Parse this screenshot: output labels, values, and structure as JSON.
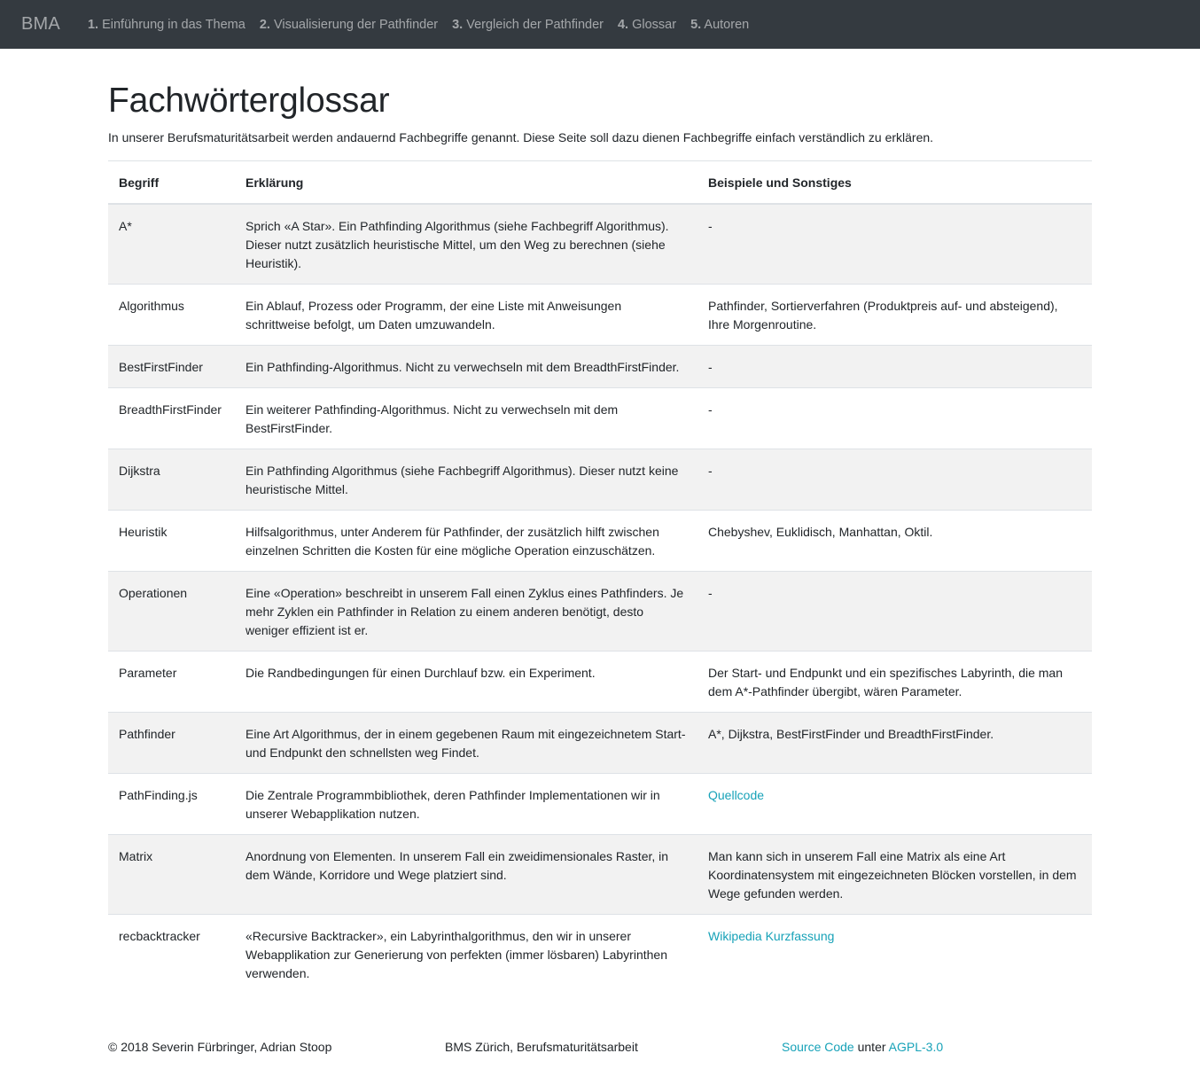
{
  "navbar": {
    "brand": "BMA",
    "links": [
      {
        "num": "1.",
        "label": "Einführung in das Thema"
      },
      {
        "num": "2.",
        "label": "Visualisierung der Pathfinder"
      },
      {
        "num": "3.",
        "label": "Vergleich der Pathfinder"
      },
      {
        "num": "4.",
        "label": "Glossar"
      },
      {
        "num": "5.",
        "label": "Autoren"
      }
    ]
  },
  "page": {
    "title": "Fachwörterglossar",
    "intro": "In unserer Berufsmaturitätsarbeit werden andauernd Fachbegriffe genannt. Diese Seite soll dazu dienen Fachbegriffe einfach verständlich zu erklären."
  },
  "table": {
    "headers": [
      "Begriff",
      "Erklärung",
      "Beispiele und Sonstiges"
    ],
    "rows": [
      {
        "term": "A*",
        "explanation": "Sprich «A Star». Ein Pathfinding Algorithmus (siehe Fachbegriff Algorithmus). Dieser nutzt zusätzlich heuristische Mittel, um den Weg zu berechnen (siehe Heuristik).",
        "extra": "-",
        "extra_is_link": false
      },
      {
        "term": "Algorithmus",
        "explanation": "Ein Ablauf, Prozess oder Programm, der eine Liste mit Anweisungen schrittweise befolgt, um Daten umzuwandeln.",
        "extra": "Pathfinder, Sortierverfahren (Produktpreis auf- und absteigend), Ihre Morgenroutine.",
        "extra_is_link": false
      },
      {
        "term": "BestFirstFinder",
        "explanation": "Ein Pathfinding-Algorithmus. Nicht zu verwechseln mit dem BreadthFirstFinder.",
        "extra": "-",
        "extra_is_link": false
      },
      {
        "term": "BreadthFirstFinder",
        "explanation": "Ein weiterer Pathfinding-Algorithmus. Nicht zu verwechseln mit dem BestFirstFinder.",
        "extra": "-",
        "extra_is_link": false
      },
      {
        "term": "Dijkstra",
        "explanation": "Ein Pathfinding Algorithmus (siehe Fachbegriff Algorithmus). Dieser nutzt keine heuristische Mittel.",
        "extra": "-",
        "extra_is_link": false
      },
      {
        "term": "Heuristik",
        "explanation": "Hilfsalgorithmus, unter Anderem für Pathfinder, der zusätzlich hilft zwischen einzelnen Schritten die Kosten für eine mögliche Operation einzuschätzen.",
        "extra": "Chebyshev, Euklidisch, Manhattan, Oktil.",
        "extra_is_link": false
      },
      {
        "term": "Operationen",
        "explanation": "Eine «Operation» beschreibt in unserem Fall einen Zyklus eines Pathfinders. Je mehr Zyklen ein Pathfinder in Relation zu einem anderen benötigt, desto weniger effizient ist er.",
        "extra": "-",
        "extra_is_link": false
      },
      {
        "term": "Parameter",
        "explanation": "Die Randbedingungen für einen Durchlauf bzw. ein Experiment.",
        "extra": "Der Start- und Endpunkt und ein spezifisches Labyrinth, die man dem A*-Pathfinder übergibt, wären Parameter.",
        "extra_is_link": false
      },
      {
        "term": "Pathfinder",
        "explanation": "Eine Art Algorithmus, der in einem gegebenen Raum mit eingezeichnetem Start- und Endpunkt den schnellsten weg Findet.",
        "extra": "A*, Dijkstra, BestFirstFinder und BreadthFirstFinder.",
        "extra_is_link": false
      },
      {
        "term": "PathFinding.js",
        "explanation": "Die Zentrale Programmbibliothek, deren Pathfinder Implementationen wir in unserer Webapplikation nutzen.",
        "extra": "Quellcode",
        "extra_is_link": true
      },
      {
        "term": "Matrix",
        "explanation": "Anordnung von Elementen. In unserem Fall ein zweidimensionales Raster, in dem Wände, Korridore und Wege platziert sind.",
        "extra": "Man kann sich in unserem Fall eine Matrix als eine Art Koordinatensystem mit eingezeichneten Blöcken vorstellen, in dem Wege gefunden werden.",
        "extra_is_link": false
      },
      {
        "term": "recbacktracker",
        "explanation": "«Recursive Backtracker», ein Labyrinthalgorithmus, den wir in unserer Webapplikation zur Generierung von perfekten (immer lösbaren) Labyrinthen verwenden.",
        "extra": "Wikipedia Kurzfassung",
        "extra_is_link": true
      }
    ]
  },
  "footer": {
    "copyright": "© 2018 Severin Fürbringer, Adrian Stoop",
    "school": "BMS Zürich, Berufsmaturitätsarbeit",
    "source_link": "Source Code",
    "under": " unter ",
    "license_link": "AGPL-3.0"
  },
  "colors": {
    "navbar_bg": "#343a40",
    "link": "#17a2b8",
    "stripe": "#f2f2f2"
  }
}
